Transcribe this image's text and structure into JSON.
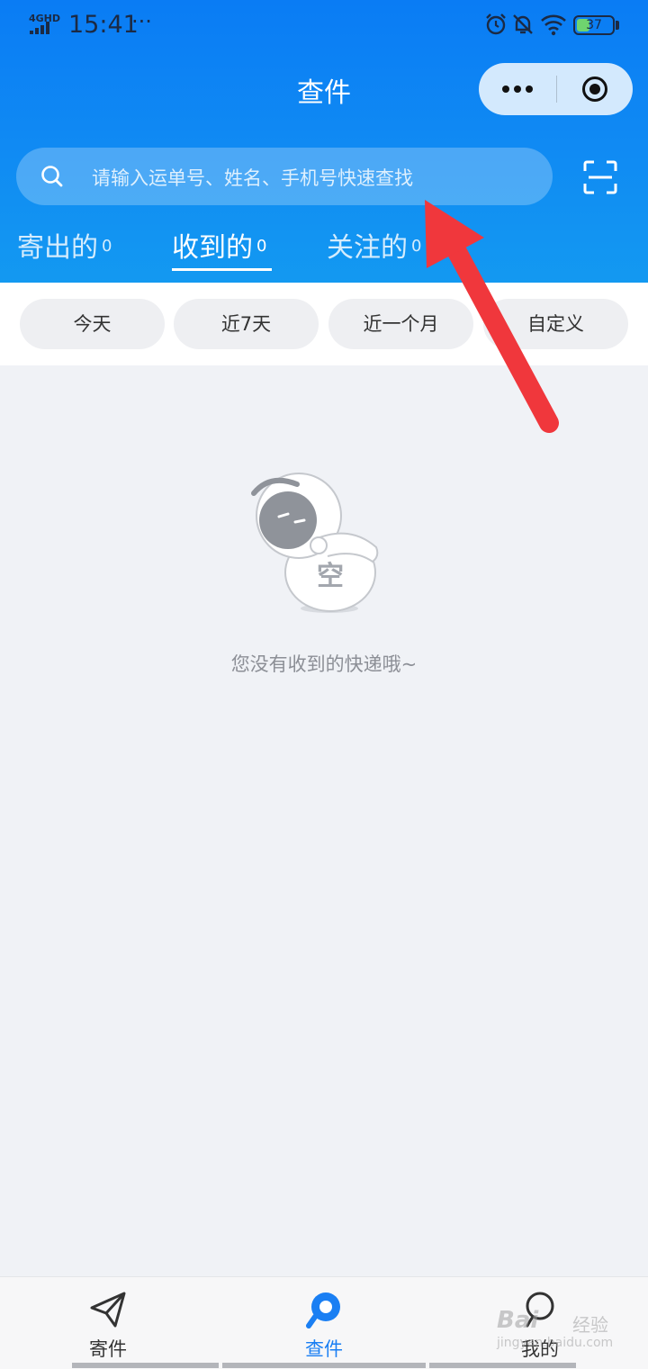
{
  "status_bar": {
    "network": "4GHD",
    "time": "15:41",
    "more_indicator": "···",
    "icons": [
      "alarm-icon",
      "bell-muted-icon",
      "wifi-icon"
    ],
    "battery_level": 37,
    "battery": "37"
  },
  "header": {
    "title": "查件",
    "capsule": {
      "more_icon": "more-dots-icon",
      "close_icon": "record-circle-icon"
    }
  },
  "search": {
    "placeholder": "请输入运单号、姓名、手机号快速查找",
    "scan_icon": "scan-icon"
  },
  "tabs": [
    {
      "label": "寄出的",
      "count": "0",
      "active": false
    },
    {
      "label": "收到的",
      "count": "0",
      "active": true
    },
    {
      "label": "关注的",
      "count": "0",
      "active": false
    }
  ],
  "filters": [
    "今天",
    "近7天",
    "近一个月",
    "自定义"
  ],
  "empty_state": {
    "illustration_text": "空",
    "message": "您没有收到的快递哦~"
  },
  "tabbar": [
    {
      "label": "寄件",
      "icon": "paper-plane-icon",
      "active": false
    },
    {
      "label": "查件",
      "icon": "search-location-icon",
      "active": true
    },
    {
      "label": "我的",
      "icon": "user-icon",
      "active": false
    }
  ],
  "watermark": {
    "main": "Bai",
    "side": "经验",
    "sub": "jingyan.baidu.com"
  },
  "colors": {
    "header_blue": "#0a7cf4",
    "active_tab": "#1a7ff3",
    "annotation_arrow": "#f0373c",
    "background": "#f0f2f6"
  }
}
